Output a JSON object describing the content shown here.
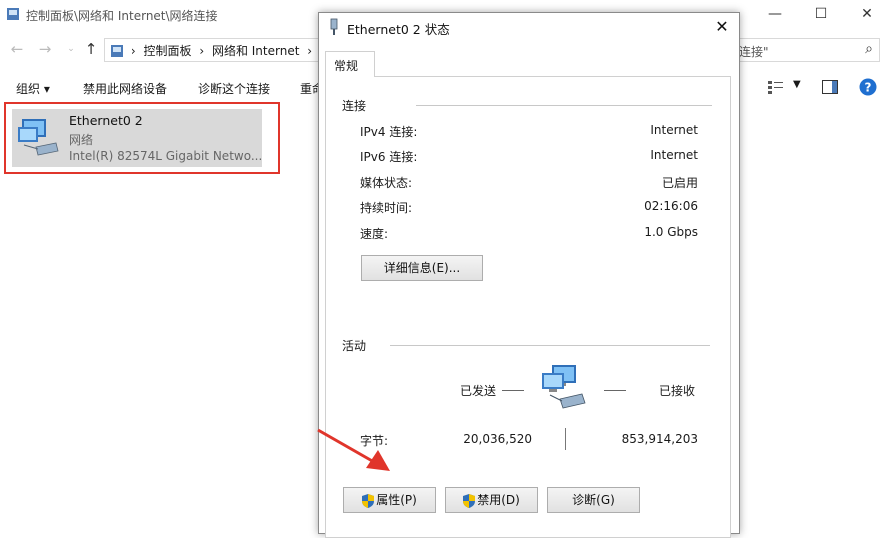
{
  "explorer": {
    "title": "控制面板\\网络和 Internet\\网络连接",
    "breadcrumb": [
      "控制面板",
      "网络和 Internet"
    ],
    "search_placeholder": "连接\"",
    "commands": [
      "组织 ▾",
      "禁用此网络设备",
      "诊断这个连接",
      "重命"
    ],
    "adapter": {
      "name": "Ethernet0 2",
      "type": "网络",
      "device": "Intel(R) 82574L Gigabit Netwo..."
    },
    "colors": {
      "highlight": "#e0352b",
      "selected_bg": "#d9d9d9"
    }
  },
  "dialog": {
    "title": "Ethernet0 2 状态",
    "tab": "常规",
    "connection": {
      "heading": "连接",
      "rows": [
        {
          "label": "IPv4 连接:",
          "value": "Internet"
        },
        {
          "label": "IPv6 连接:",
          "value": "Internet"
        },
        {
          "label": "媒体状态:",
          "value": "已启用"
        },
        {
          "label": "持续时间:",
          "value": "02:16:06"
        },
        {
          "label": "速度:",
          "value": "1.0 Gbps"
        }
      ],
      "details_button": "详细信息(E)..."
    },
    "activity": {
      "heading": "活动",
      "sent_label": "已发送",
      "received_label": "已接收",
      "bytes_label": "字节:",
      "bytes_sent": "20,036,520",
      "bytes_received": "853,914,203"
    },
    "buttons": {
      "properties": "属性(P)",
      "disable": "禁用(D)",
      "diagnose": "诊断(G)"
    }
  }
}
